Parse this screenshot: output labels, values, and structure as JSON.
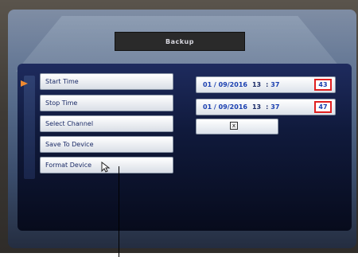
{
  "window": {
    "title": "Backup"
  },
  "menu": {
    "items": [
      {
        "label": "Start Time"
      },
      {
        "label": "Stop Time"
      },
      {
        "label": "Select Channel"
      },
      {
        "label": "Save To Device"
      },
      {
        "label": "Format Device"
      }
    ]
  },
  "start_time": {
    "date": "01 / 09/2016",
    "hour": "13",
    "minute": "37",
    "second": "43"
  },
  "stop_time": {
    "date": "01 / 09/2016",
    "hour": "13",
    "minute": "37",
    "second": "47"
  },
  "channel": {
    "checkbox_label": "x",
    "checked": true
  },
  "colors": {
    "accent_arrow": "#f08a30",
    "seconds_box": "#e02020",
    "field_text": "#1a3fb0"
  }
}
